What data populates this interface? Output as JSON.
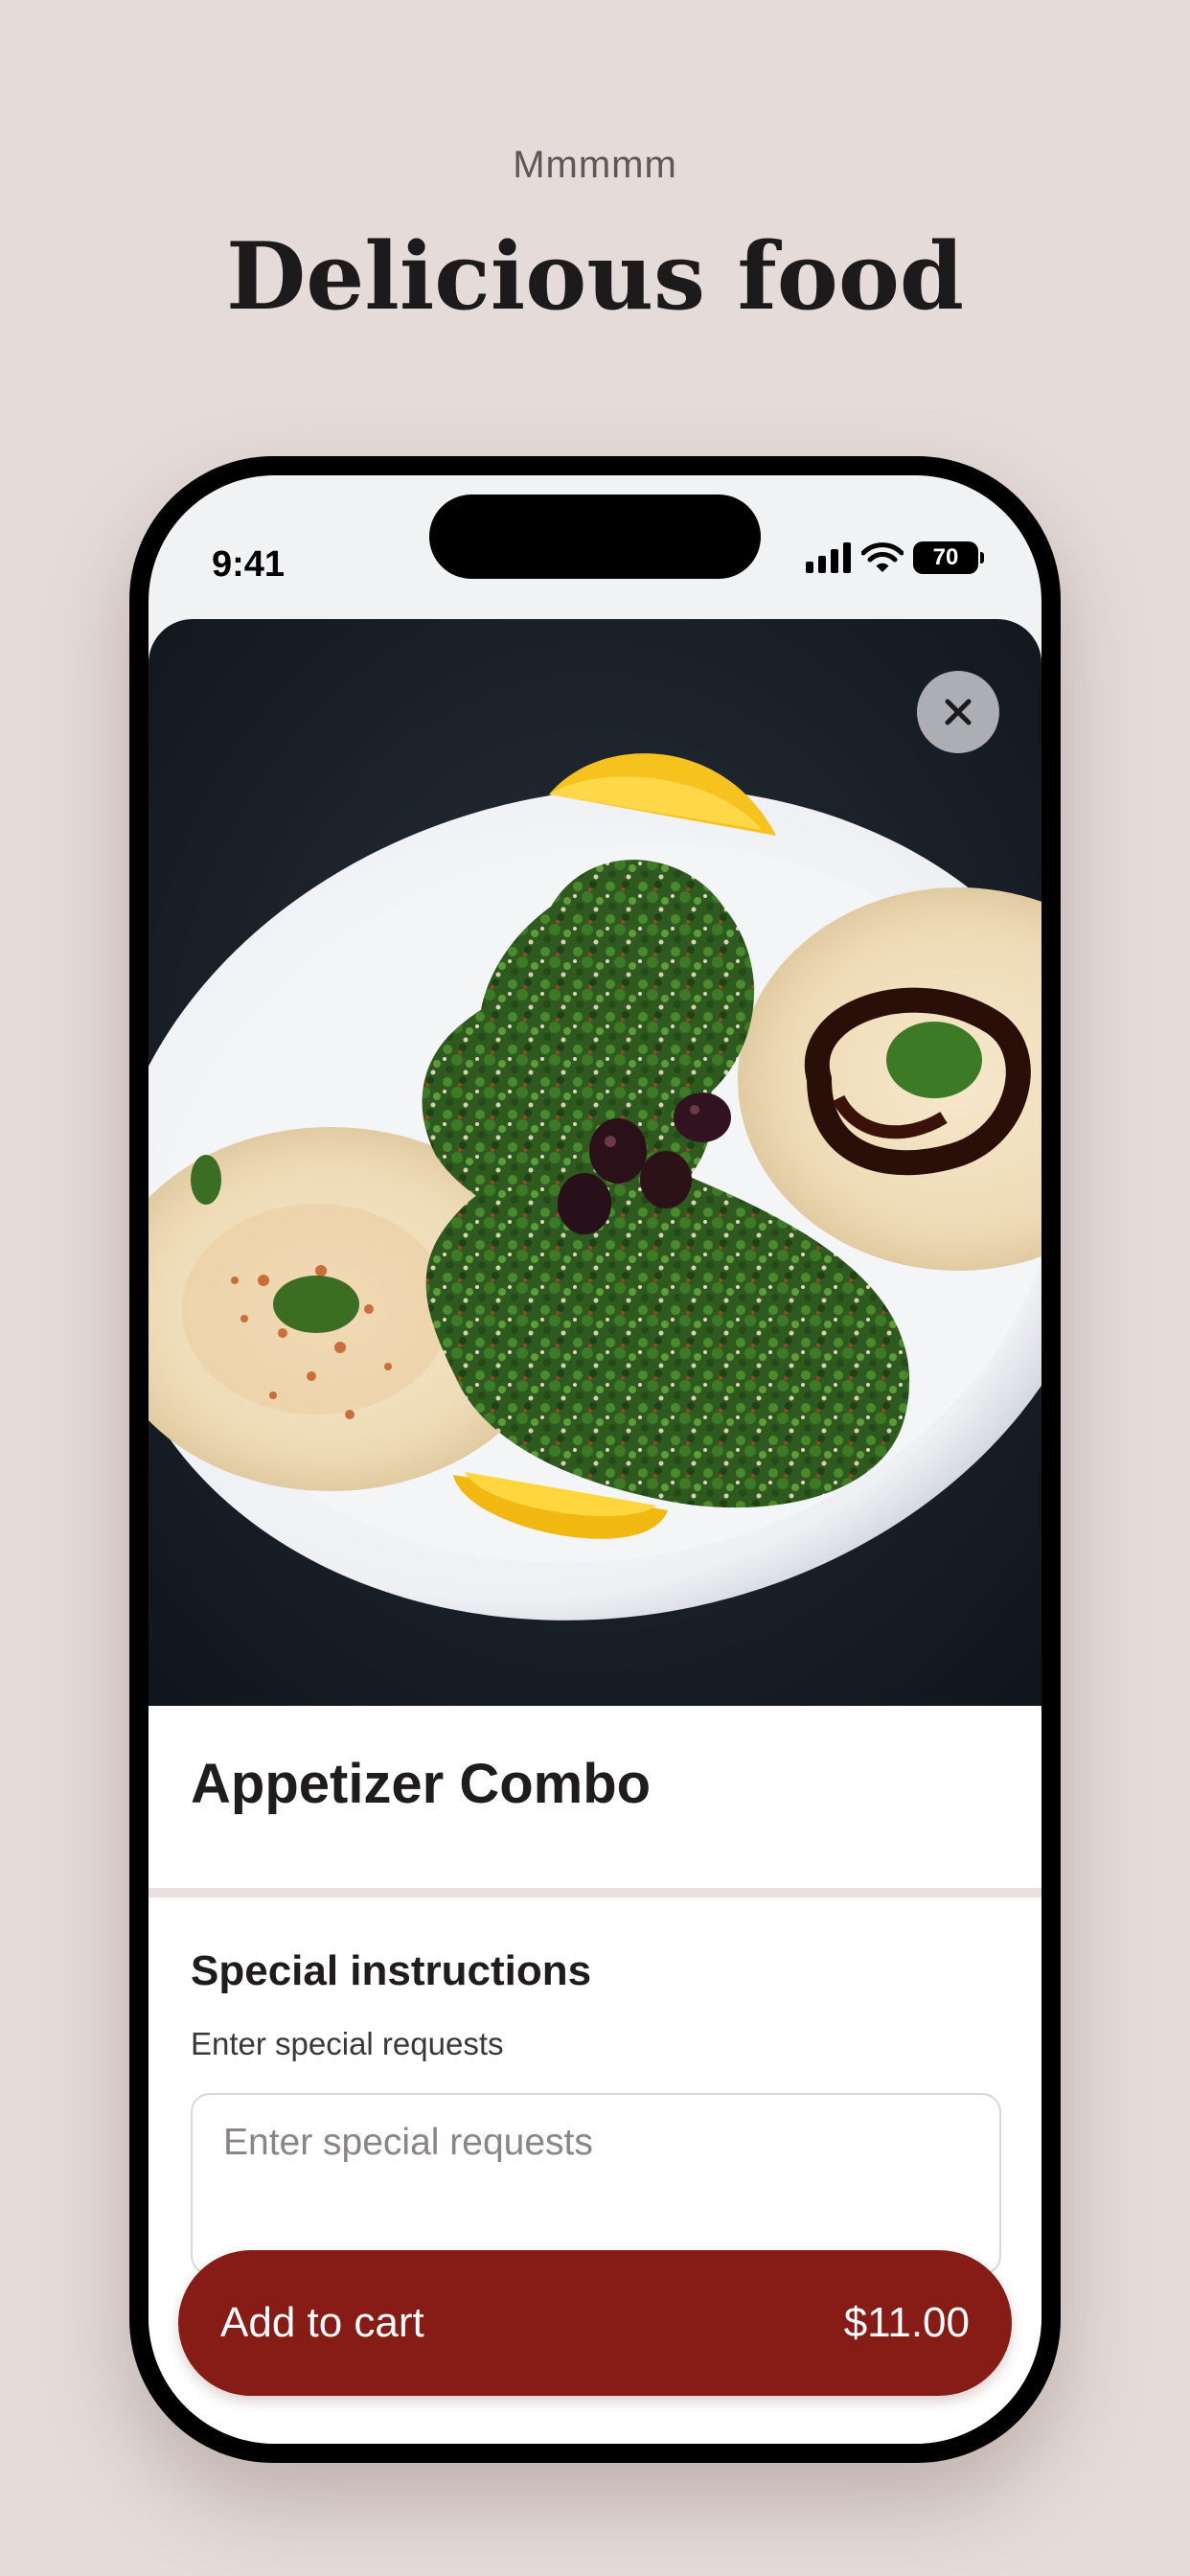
{
  "header": {
    "eyebrow": "Mmmmm",
    "headline": "Delicious food"
  },
  "status_bar": {
    "time": "9:41",
    "battery": "70",
    "icons": [
      "cellular-signal-icon",
      "wifi-icon",
      "battery-icon"
    ]
  },
  "item": {
    "image_icon": "food-photo",
    "close_icon": "close-icon",
    "title": "Appetizer Combo"
  },
  "special_instructions": {
    "title": "Special instructions",
    "subtitle": "Enter special requests",
    "placeholder": "Enter special requests",
    "value": ""
  },
  "cart_button": {
    "label": "Add to cart",
    "price": "$11.00"
  },
  "colors": {
    "page_background": "#e5dcda",
    "accent": "#861c15",
    "text": "#1e1c1c"
  }
}
